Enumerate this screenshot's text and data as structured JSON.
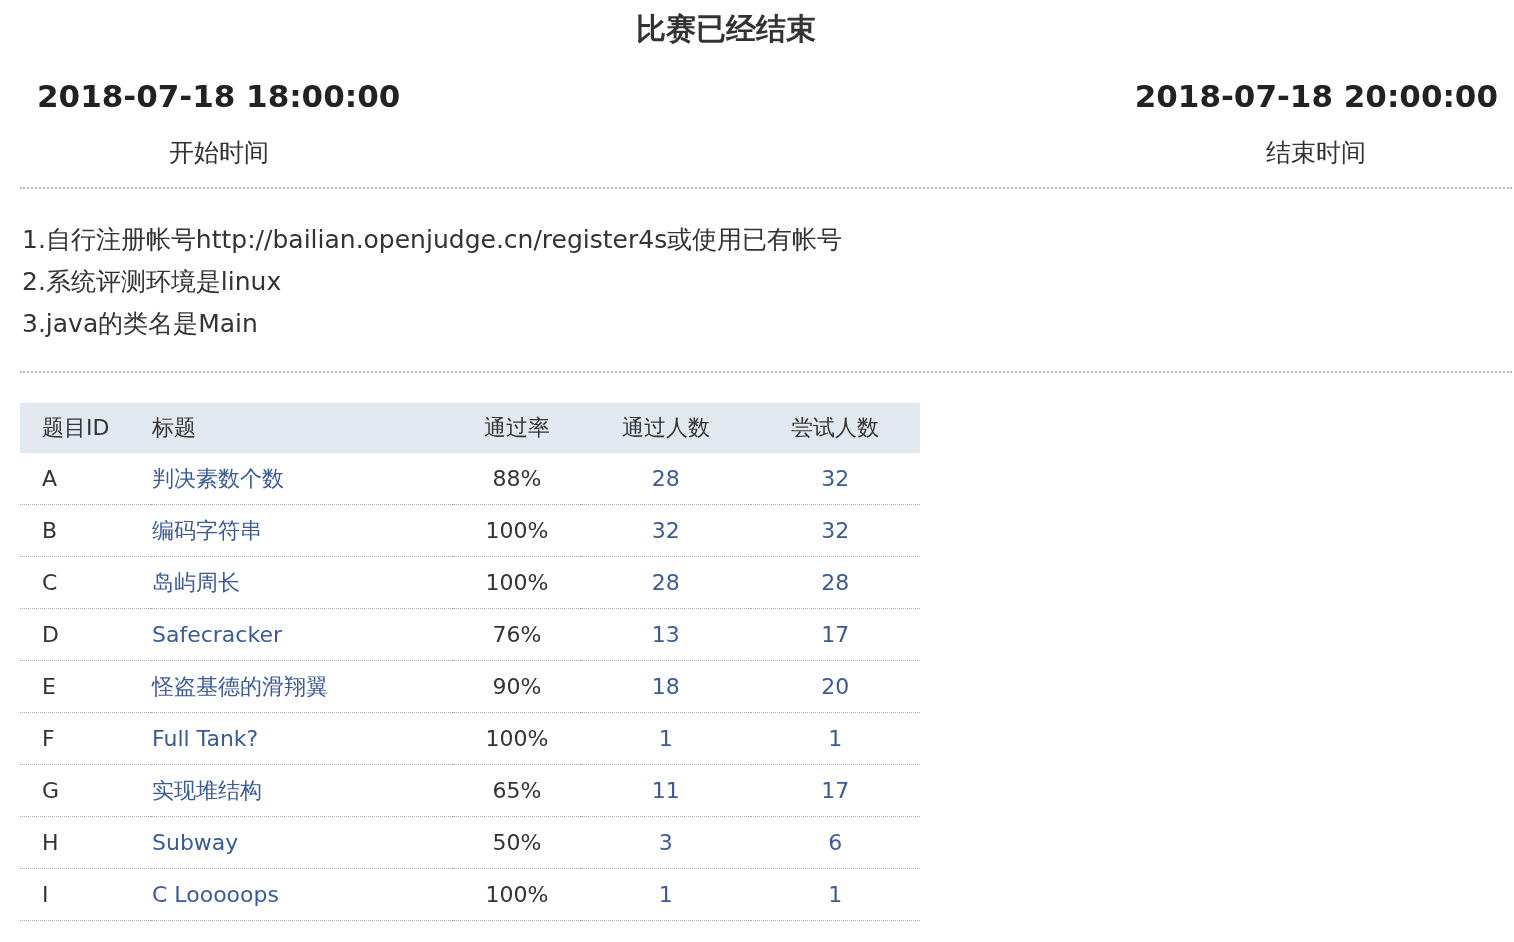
{
  "title": "比赛已经结束",
  "start": {
    "time": "2018-07-18 18:00:00",
    "label": "开始时间"
  },
  "end": {
    "time": "2018-07-18 20:00:00",
    "label": "结束时间"
  },
  "rules": [
    "1.自行注册帐号http://bailian.openjudge.cn/register4s或使用已有帐号",
    "2.系统评测环境是linux",
    "3.java的类名是Main"
  ],
  "table": {
    "columns": [
      "题目ID",
      "标题",
      "通过率",
      "通过人数",
      "尝试人数"
    ],
    "rows": [
      {
        "id": "A",
        "title": "判决素数个数",
        "rate": "88%",
        "passed": "28",
        "tried": "32"
      },
      {
        "id": "B",
        "title": "编码字符串",
        "rate": "100%",
        "passed": "32",
        "tried": "32"
      },
      {
        "id": "C",
        "title": "岛屿周长",
        "rate": "100%",
        "passed": "28",
        "tried": "28"
      },
      {
        "id": "D",
        "title": "Safecracker",
        "rate": "76%",
        "passed": "13",
        "tried": "17"
      },
      {
        "id": "E",
        "title": "怪盗基德的滑翔翼",
        "rate": "90%",
        "passed": "18",
        "tried": "20"
      },
      {
        "id": "F",
        "title": "Full Tank?",
        "rate": "100%",
        "passed": "1",
        "tried": "1"
      },
      {
        "id": "G",
        "title": "实现堆结构",
        "rate": "65%",
        "passed": "11",
        "tried": "17"
      },
      {
        "id": "H",
        "title": "Subway",
        "rate": "50%",
        "passed": "3",
        "tried": "6"
      },
      {
        "id": "I",
        "title": "C Looooops",
        "rate": "100%",
        "passed": "1",
        "tried": "1"
      }
    ]
  }
}
